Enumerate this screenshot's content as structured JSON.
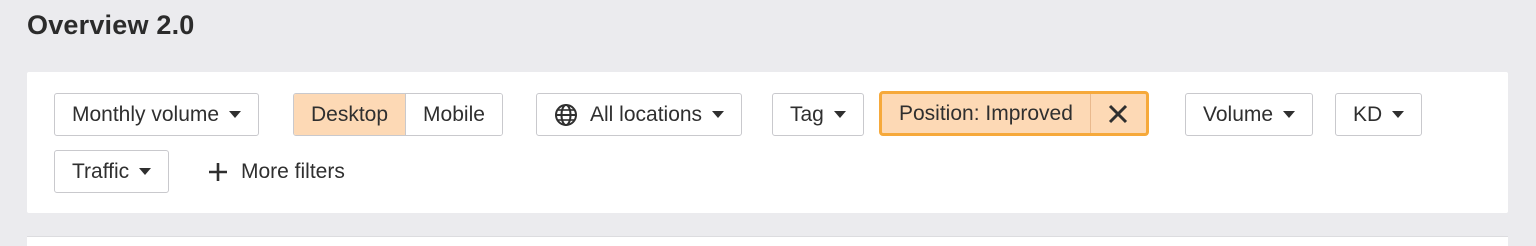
{
  "page": {
    "title": "Overview 2.0"
  },
  "filters": {
    "monthly_volume": "Monthly volume",
    "device": {
      "options": [
        "Desktop",
        "Mobile"
      ],
      "selected": "Desktop"
    },
    "locations": "All locations",
    "tag": "Tag",
    "active_filter": "Position: Improved",
    "volume": "Volume",
    "kd": "KD",
    "traffic": "Traffic",
    "more_filters": "More filters"
  },
  "colors": {
    "active_bg": "#fdd9b5",
    "active_border": "#f6a93b",
    "page_bg": "#ebebee",
    "panel_bg": "#ffffff"
  },
  "icons": {
    "locations": "globe-icon",
    "dropdown": "caret-down-icon",
    "remove": "close-icon",
    "more": "plus-icon"
  }
}
